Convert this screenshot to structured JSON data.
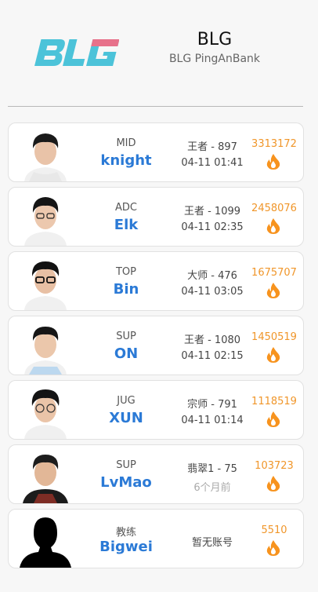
{
  "header": {
    "logo_text": "BLG",
    "team_name": "BLG",
    "team_full_name": "BLG PingAnBank",
    "logo_colors": {
      "main": "#4cc3d9",
      "accent": "#e7718a"
    }
  },
  "players": [
    {
      "role": "MID",
      "name": "knight",
      "rank": "王者 - 897",
      "time": "04-11 01:41",
      "score": "3313172",
      "avatar_icon": "player-photo-icon",
      "fire_icon": "fire-icon"
    },
    {
      "role": "ADC",
      "name": "Elk",
      "rank": "王者 - 1099",
      "time": "04-11 02:35",
      "score": "2458076",
      "avatar_icon": "player-photo-icon",
      "fire_icon": "fire-icon"
    },
    {
      "role": "TOP",
      "name": "Bin",
      "rank": "大师 - 476",
      "time": "04-11 03:05",
      "score": "1675707",
      "avatar_icon": "player-photo-icon",
      "fire_icon": "fire-icon"
    },
    {
      "role": "SUP",
      "name": "ON",
      "rank": "王者 - 1080",
      "time": "04-11 02:15",
      "score": "1450519",
      "avatar_icon": "player-photo-icon",
      "fire_icon": "fire-icon"
    },
    {
      "role": "JUG",
      "name": "XUN",
      "rank": "宗师 - 791",
      "time": "04-11 01:14",
      "score": "1118519",
      "avatar_icon": "player-photo-icon",
      "fire_icon": "fire-icon"
    },
    {
      "role": "SUP",
      "name": "LvMao",
      "rank": "翡翠1 - 75",
      "time": "6个月前",
      "score": "103723",
      "avatar_icon": "player-photo-icon",
      "fire_icon": "fire-icon"
    },
    {
      "role": "教练",
      "name": "Bigwei",
      "rank": "暂无账号",
      "time": "",
      "score": "5510",
      "avatar_icon": "silhouette-icon",
      "fire_icon": "fire-icon"
    }
  ],
  "colors": {
    "name": "#2b7ad6",
    "score": "#f0962a",
    "fire": "#f7931e",
    "muted_time": "#aaaaaa"
  }
}
